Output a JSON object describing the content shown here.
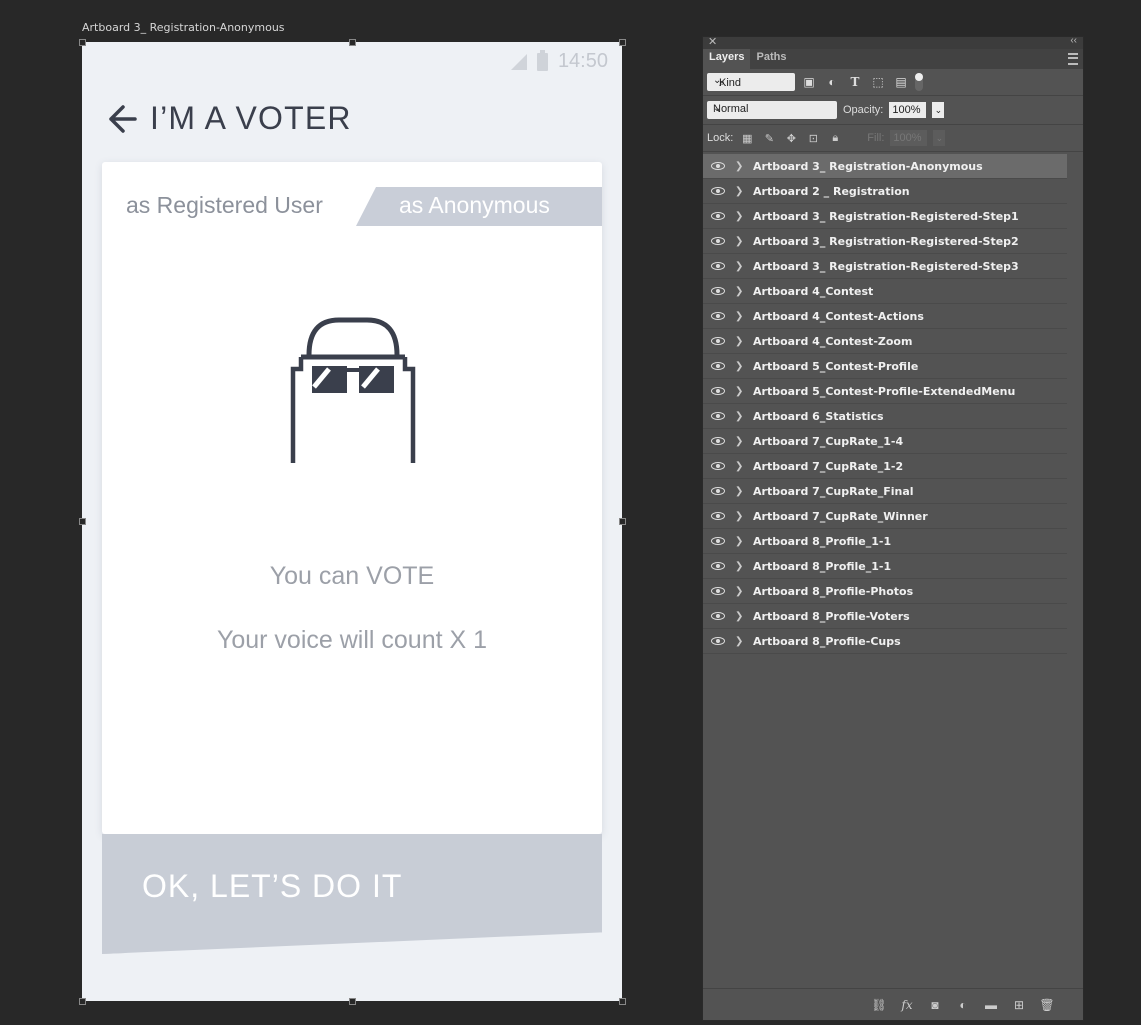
{
  "artboard": {
    "label": "Artboard 3_ Registration-Anonymous",
    "status_time": "14:50",
    "title": "I’M A VOTER",
    "tab_registered": "as Registered User",
    "tab_anonymous": "as Anonymous",
    "line1": "You can VOTE",
    "line2": "Your voice will count X 1",
    "cta": "OK, LET’S DO IT"
  },
  "panel": {
    "tabs": [
      "Layers",
      "Paths"
    ],
    "filter_kind": "Kind",
    "blend_mode": "Normal",
    "opacity_label": "Opacity:",
    "opacity_value": "100%",
    "lock_label": "Lock:",
    "fill_label": "Fill:",
    "fill_value": "100%",
    "layers": [
      "Artboard 3_ Registration-Anonymous",
      "Artboard 2 _ Registration",
      "Artboard 3_ Registration-Registered-Step1",
      "Artboard 3_ Registration-Registered-Step2",
      "Artboard 3_ Registration-Registered-Step3",
      "Artboard 4_Contest",
      "Artboard 4_Contest-Actions",
      "Artboard 4_Contest-Zoom",
      "Artboard 5_Contest-Profile",
      "Artboard 5_Contest-Profile-ExtendedMenu",
      "Artboard 6_Statistics",
      "Artboard 7_CupRate_1-4",
      "Artboard 7_CupRate_1-2",
      "Artboard 7_CupRate_Final",
      "Artboard 7_CupRate_Winner",
      "Artboard 8_Profile_1-1",
      "Artboard 8_Profile_1-1",
      "Artboard 8_Profile-Photos",
      "Artboard 8_Profile-Voters",
      "Artboard 8_Profile-Cups"
    ]
  }
}
